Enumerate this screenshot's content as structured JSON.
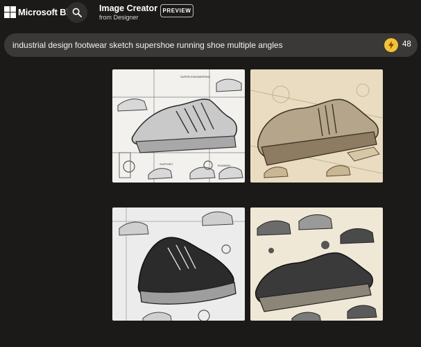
{
  "header": {
    "brand": "Microsoft Bing",
    "title": "Image Creator",
    "subtitle": "from Designer",
    "badge": "PREVIEW",
    "icons": {
      "logo": "microsoft-logo-icon",
      "search": "search-icon"
    }
  },
  "prompt": {
    "text": "industrial design footwear sketch supershoe running shoe multiple angles",
    "boosts": "48",
    "icons": {
      "boost": "lightning-icon"
    },
    "colors": {
      "boost": "#f5c136",
      "bar": "#3a3937"
    }
  },
  "grid": {
    "images": [
      {
        "label": "SUPER-ENGINEERING",
        "label2": "SUPPORT",
        "label3": "RUNNING",
        "style": "light-technical"
      },
      {
        "style": "sepia"
      },
      {
        "style": "grey-bw"
      },
      {
        "style": "cream-collage"
      }
    ]
  },
  "colors": {
    "background": "#1b1a19"
  }
}
